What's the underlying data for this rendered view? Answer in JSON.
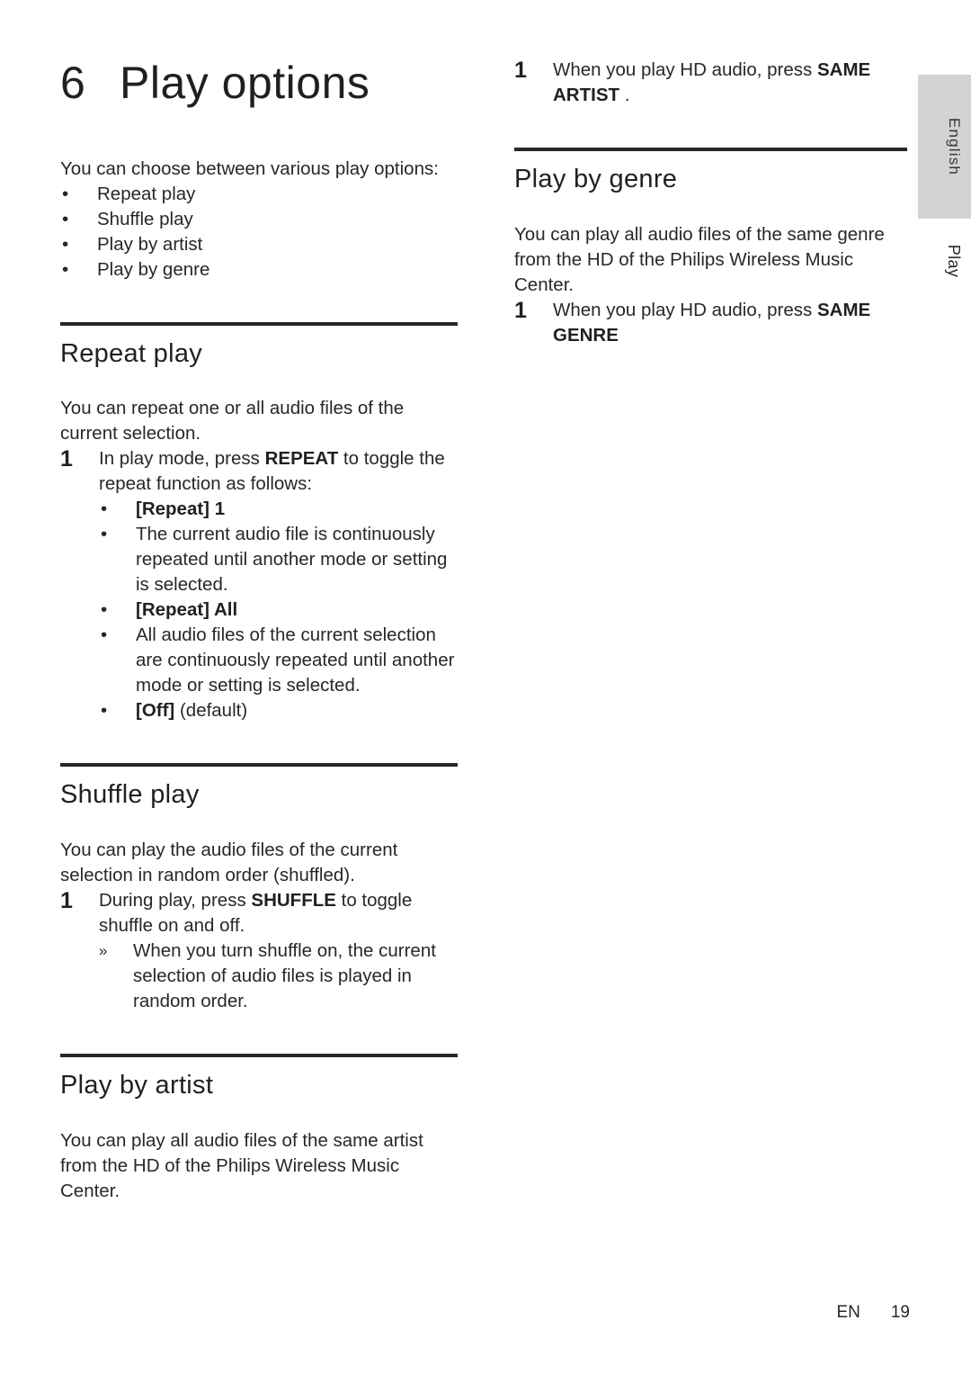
{
  "chapter": {
    "number": "6",
    "title": "Play options"
  },
  "left_column": {
    "intro": "You can choose between various play options:",
    "intro_bullets": [
      "Repeat play",
      "Shuffle play",
      "Play by artist",
      "Play by genre"
    ],
    "sections": [
      {
        "heading": "Repeat play",
        "body": "You can repeat one or all audio files of the current selection.",
        "step_number": "1",
        "step_prefix": "In play mode, press ",
        "step_bold": "REPEAT",
        "step_suffix": " to toggle the repeat function as follows:",
        "options": [
          {
            "bold": "[Repeat] 1",
            "plain": ""
          },
          {
            "bold": "",
            "plain": "The current audio file is continuously repeated until another mode or setting is selected."
          },
          {
            "bold": "[Repeat] All",
            "plain": ""
          },
          {
            "bold": "",
            "plain": "All audio files of the current selection are continuously repeated until another mode or setting is selected."
          },
          {
            "bold": "[Off]",
            "plain": " (default)"
          }
        ]
      },
      {
        "heading": "Shuffle play",
        "body": "You can play the audio files of the current selection in random order (shuffled).",
        "step_number": "1",
        "step_prefix": "During play, press ",
        "step_bold": "SHUFFLE",
        "step_suffix": " to toggle shuffle on and off.",
        "result_marker": "»",
        "result": "When you turn shuffle on, the current selection of audio files is played in random order."
      },
      {
        "heading": "Play by artist",
        "body": "You can play all audio files of the same artist from the HD of the Philips Wireless Music Center."
      }
    ]
  },
  "right_column": {
    "artist_step": {
      "number": "1",
      "prefix": "When you play HD audio, press ",
      "bold": "SAME ARTIST",
      "suffix": " ."
    },
    "genre_section": {
      "heading": "Play by genre",
      "body": "You can play all audio files of the same genre from the HD of the Philips Wireless Music Center.",
      "step": {
        "number": "1",
        "prefix": "When you play HD audio, press ",
        "bold": "SAME GENRE",
        "suffix": ""
      }
    }
  },
  "side_tab": {
    "language": "English",
    "section_label": "Play"
  },
  "footer": {
    "language_code": "EN",
    "page_number": "19"
  },
  "colors": {
    "text": "#2b2627",
    "rule": "#2b2627",
    "tab_background": "#d2d3d5"
  }
}
